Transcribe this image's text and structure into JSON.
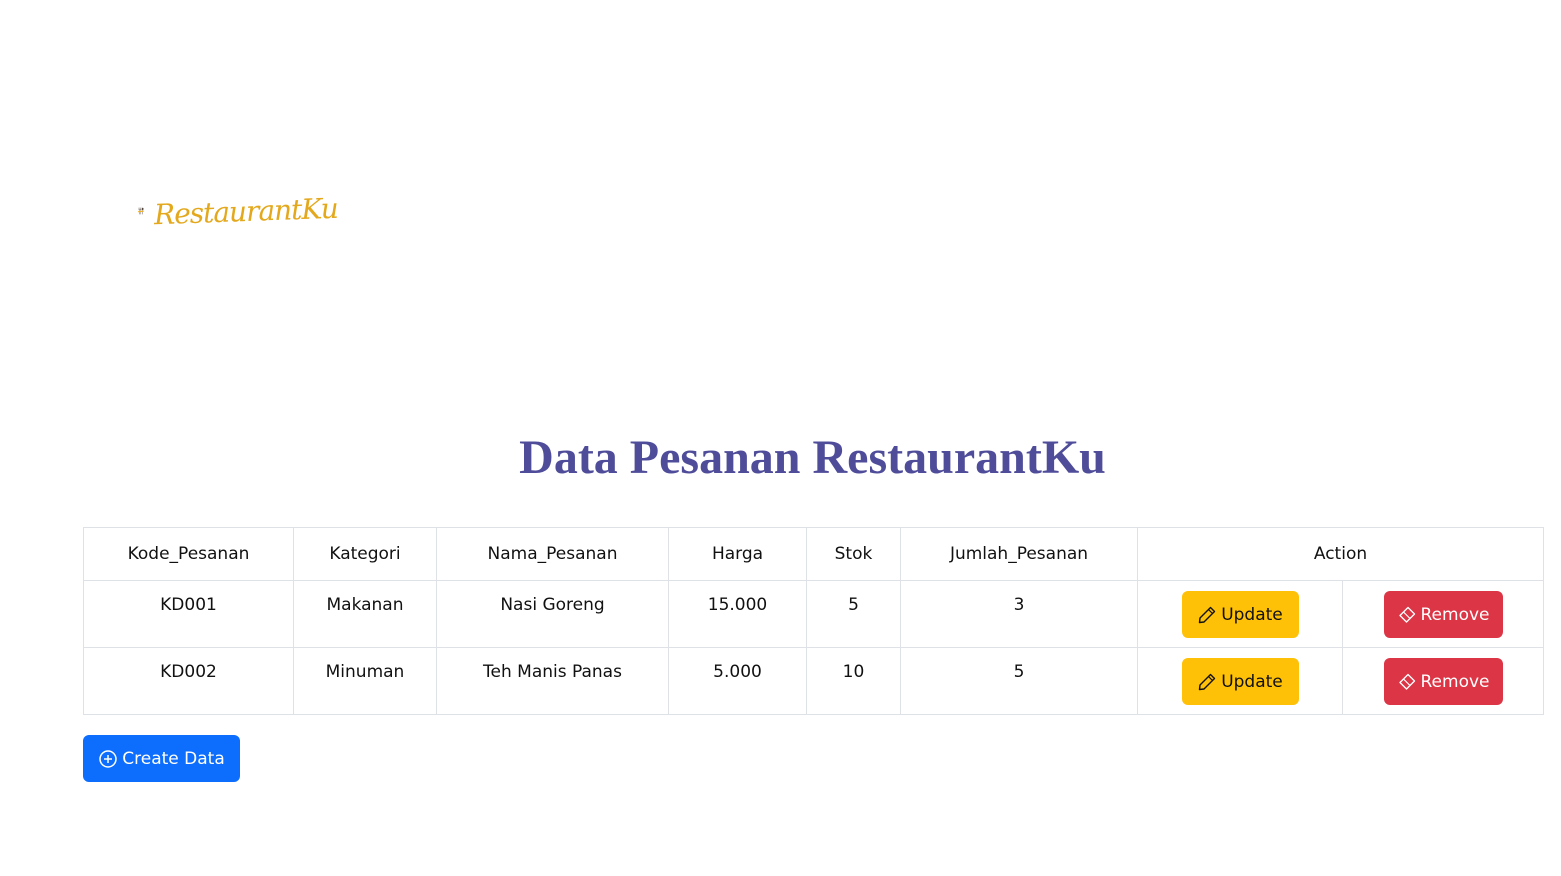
{
  "brand": {
    "name": "RestaurantKu",
    "logo_icon": "fork-spoon-icon",
    "accent_color": "#e3a81c"
  },
  "page": {
    "title": "Data Pesanan RestaurantKu",
    "title_color": "#4f4d99"
  },
  "table": {
    "headers": [
      "Kode_Pesanan",
      "Kategori",
      "Nama_Pesanan",
      "Harga",
      "Stok",
      "Jumlah_Pesanan",
      "Action"
    ],
    "rows": [
      {
        "kode": "KD001",
        "kategori": "Makanan",
        "nama": "Nasi Goreng",
        "harga": "15.000",
        "stok": "5",
        "jumlah": "3"
      },
      {
        "kode": "KD002",
        "kategori": "Minuman",
        "nama": "Teh Manis Panas",
        "harga": "5.000",
        "stok": "10",
        "jumlah": "5"
      }
    ],
    "update_label": "Update",
    "remove_label": "Remove",
    "update_color": "#ffc107",
    "remove_color": "#dc3545"
  },
  "actions": {
    "create_label": "Create Data",
    "create_color": "#0d6efd"
  }
}
